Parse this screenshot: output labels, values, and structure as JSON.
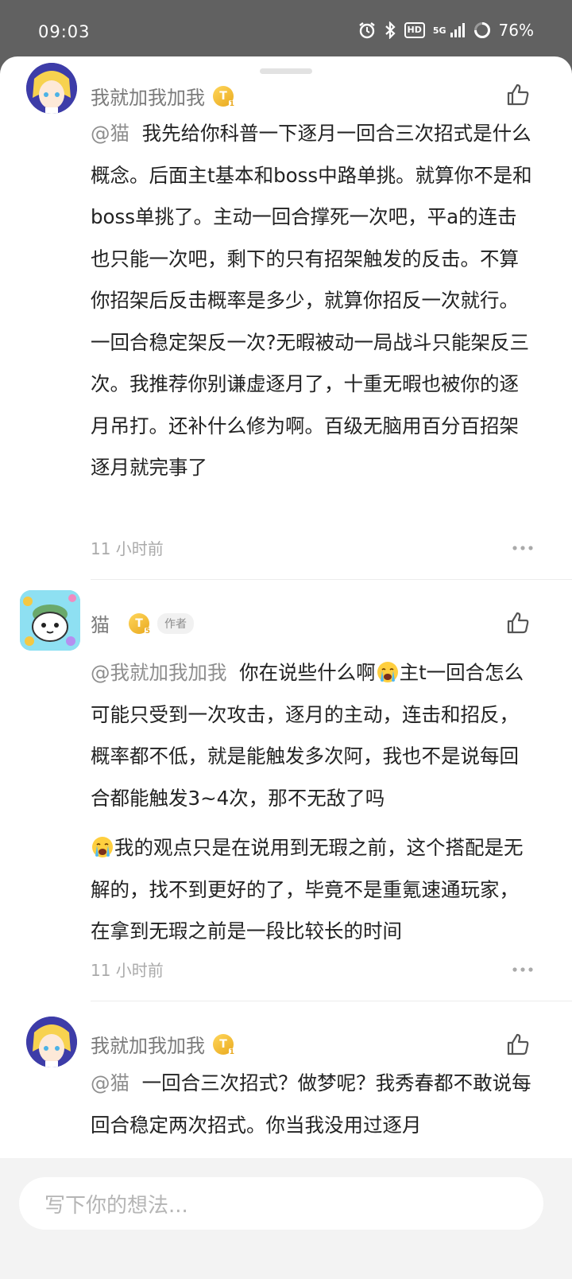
{
  "status_bar": {
    "time": "09:03",
    "network": "5G",
    "hd": "HD",
    "battery": "76%"
  },
  "comments": [
    {
      "author": "我就加我加我",
      "badge_level": "T",
      "badge_sub": "1",
      "mention": "@猫",
      "text": "  我先给你科普一下逐月一回合三次招式是什么概念。后面主t基本和boss中路单挑。就算你不是和boss单挑了。主动一回合撑死一次吧，平a的连击也只能一次吧，剩下的只有招架触发的反击。不算你招架后反击概率是多少，就算你招反一次就行。一回合稳定架反一次?无暇被动一局战斗只能架反三次。我推荐你别谦虚逐月了，十重无暇也被你的逐月吊打。还补什么修为啊。百级无脑用百分百招架逐月就完事了",
      "time": "11 小时前"
    },
    {
      "author": "猫",
      "badge_level": "T",
      "badge_sub": "5",
      "author_tag": "作者",
      "mention": "@我就加我加我",
      "text_part1": "  你在说些什么啊",
      "text_part2": "主t一回合怎么可能只受到一次攻击，逐月的主动，连击和招反，概率都不低，就是能触发多次阿，我也不是说每回合都能触发3~4次，那不无敌了吗",
      "text_part3": "我的观点只是在说用到无瑕之前，这个搭配是无解的，找不到更好的了，毕竟不是重氪速通玩家，在拿到无瑕之前是一段比较长的时间",
      "time": "11 小时前"
    },
    {
      "author": "我就加我加我",
      "badge_level": "T",
      "badge_sub": "1",
      "mention": "@猫",
      "text": "  一回合三次招式？做梦呢？我秀春都不敢说每回合稳定两次招式。你当我没用过逐月"
    }
  ],
  "reply_box": {
    "placeholder": "写下你的想法..."
  }
}
